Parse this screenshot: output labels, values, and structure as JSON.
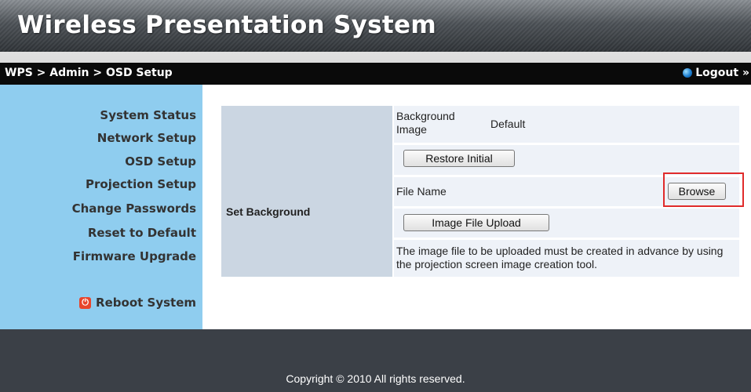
{
  "header": {
    "title": "Wireless Presentation System"
  },
  "navbar": {
    "breadcrumb": "WPS > Admin > OSD Setup",
    "logout": "Logout »"
  },
  "sidebar": {
    "items": [
      {
        "label": "System Status"
      },
      {
        "label": "Network Setup"
      },
      {
        "label": "OSD Setup"
      },
      {
        "label": "Projection Setup"
      },
      {
        "label": "Change Passwords"
      },
      {
        "label": "Reset to Default"
      },
      {
        "label": "Firmware Upgrade"
      }
    ],
    "reboot": "Reboot System"
  },
  "main": {
    "section_label": "Set Background",
    "background_image_label": "Background Image",
    "background_image_value": "Default",
    "restore_button": "Restore Initial",
    "file_name_label": "File Name",
    "file_name_value": "",
    "browse_button": "Browse",
    "upload_button": "Image File Upload",
    "note": "The image file to be uploaded must be created in advance by using the projection screen image creation tool."
  },
  "footer": {
    "copyright": "Copyright © 2010 All rights reserved."
  },
  "colors": {
    "sidebar_bg": "#8fcdef",
    "navbar_bg": "#0a0a0a",
    "footer_bg": "#3b4047",
    "highlight": "#e02b2b"
  }
}
